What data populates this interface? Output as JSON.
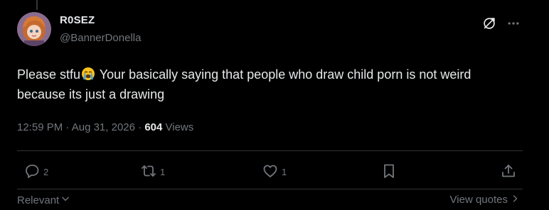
{
  "tweet": {
    "author_name": "R0SEZ",
    "author_handle": "@BannerDonella",
    "text_before_emoji": "Please stfu",
    "emoji": "loudly-crying-face",
    "text_after_emoji": " Your basically saying that people who draw child porn is not weird because its just a drawing",
    "time": "12:59 PM",
    "date": "Aug 31, 2026",
    "separator": "·",
    "views_count": "604",
    "views_label": " Views"
  },
  "actions": {
    "reply_count": "2",
    "retweet_count": "1",
    "like_count": "1"
  },
  "footer": {
    "sort_label": "Relevant",
    "quotes_label": "View quotes"
  },
  "icons": {
    "header": [
      "grok-icon",
      "more-icon"
    ],
    "actions": [
      "reply-icon",
      "retweet-icon",
      "like-icon",
      "bookmark-icon",
      "share-icon"
    ]
  },
  "colors": {
    "background": "#000000",
    "text": "#e7e9ea",
    "secondary": "#71767b",
    "divider": "#2f3336"
  }
}
